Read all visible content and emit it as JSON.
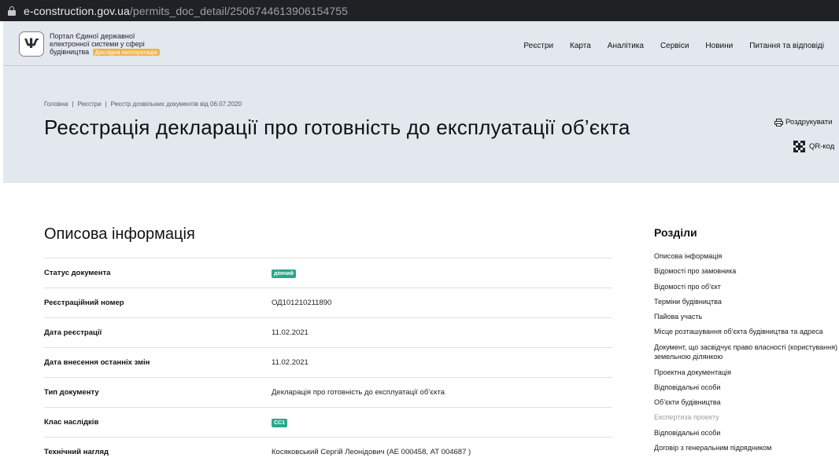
{
  "browser": {
    "url_domain": "e-construction.gov.ua",
    "url_path": "/permits_doc_detail/2506744613906154755"
  },
  "header": {
    "logo_symbol": "Ѱ",
    "portal_title": "Портал Єдиної державної електронної системи у сфері будівництва",
    "beta_badge": "Дослідна експлуатація",
    "nav": [
      "Реєстри",
      "Карта",
      "Аналітика",
      "Сервіси",
      "Новини",
      "Питання та відповіді"
    ]
  },
  "breadcrumb": [
    "Головна",
    "Реєстри",
    "Реєстр дозвільних документів від 06.07.2020"
  ],
  "page_title": "Реєстрація декларації про готовність до експлуатації об’єкта",
  "actions": {
    "print": "Роздрукувати",
    "qr": "QR-код"
  },
  "section": {
    "title": "Описова інформація",
    "rows": [
      {
        "label": "Статус документа",
        "value": "діючий",
        "badge": true
      },
      {
        "label": "Реєстраційний номер",
        "value": "ОД101210211890",
        "badge": false
      },
      {
        "label": "Дата реєстрації",
        "value": "11.02.2021",
        "badge": false
      },
      {
        "label": "Дата внесення останніх змін",
        "value": "11.02.2021",
        "badge": false
      },
      {
        "label": "Тип документу",
        "value": "Декларація про готовність до експлуатації об’єкта",
        "badge": false
      },
      {
        "label": "Клас наслідків",
        "value": "СС1",
        "badge": true
      },
      {
        "label": "Технічний нагляд",
        "value": "Косяковський Сергій Леонідович (АЕ 000458, АТ 004687 )",
        "badge": false
      }
    ]
  },
  "sidebar": {
    "title": "Розділи",
    "items": [
      {
        "label": "Описова інформація",
        "muted": false
      },
      {
        "label": "Відомості про замовника",
        "muted": false
      },
      {
        "label": "Відомості про об’єкт",
        "muted": false
      },
      {
        "label": "Терміни будівництва",
        "muted": false
      },
      {
        "label": "Пайова участь",
        "muted": false
      },
      {
        "label": "Місце розташування об’єкта будівництва та адреса",
        "muted": false
      },
      {
        "label": "Документ, що засвідчує право власності (користування) земельною ділянкою",
        "muted": false
      },
      {
        "label": "Проектна документація",
        "muted": false
      },
      {
        "label": "Відповідальні особи",
        "muted": false
      },
      {
        "label": "Об’єкти будівництва",
        "muted": false
      },
      {
        "label": "Експертиза проекту",
        "muted": true
      },
      {
        "label": "Відповідальні особи",
        "muted": false
      },
      {
        "label": "Договір з генеральним підрядником",
        "muted": false
      }
    ]
  },
  "colors": {
    "header_bg": "#e3e8ee",
    "badge_green": "#2aa78b",
    "beta_orange": "#f0b451",
    "browser_bar": "#202124"
  }
}
